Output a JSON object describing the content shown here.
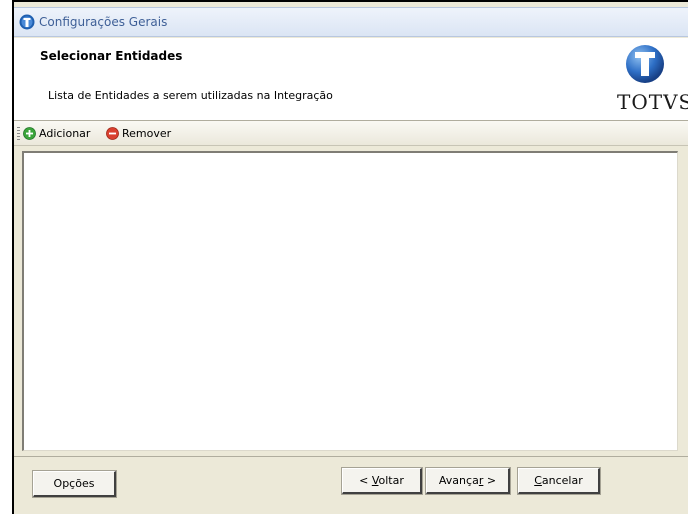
{
  "window": {
    "title": "Configurações Gerais",
    "icon": "totvs-app-icon"
  },
  "header": {
    "title": "Selecionar Entidades",
    "subtitle": "Lista de Entidades a serem utilizadas na Integração",
    "logo_text": "TOTVS"
  },
  "toolbar": {
    "add_label": "Adicionar",
    "add_icon": "plus-circle-icon",
    "remove_label": "Remover",
    "remove_icon": "minus-circle-icon"
  },
  "entities_list": {
    "items": []
  },
  "footer": {
    "options_label": "Opções",
    "back": {
      "prefix": "< ",
      "mnemonic": "V",
      "rest": "oltar"
    },
    "next": {
      "prefix": "Avança",
      "mnemonic": "r",
      "suffix": " >"
    },
    "cancel": {
      "mnemonic": "C",
      "rest": "ancelar"
    }
  },
  "colors": {
    "window_bg": "#ece9d8",
    "title_text": "#3e5f97",
    "add_green": "#3aa53a",
    "remove_red": "#d9402f",
    "logo_blue": "#1f5fb0"
  }
}
